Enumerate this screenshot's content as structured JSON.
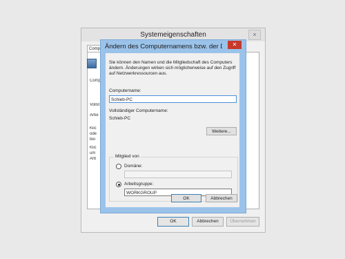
{
  "background_window": {
    "title": "Systemeigenschaften",
    "close_glyph": "×",
    "tab_label": "Compu",
    "fragments": [
      "Comp",
      "Vollst",
      "Arbe",
      "Klic",
      "ode",
      "bei",
      "Klic",
      "um",
      "Arb"
    ],
    "buttons": {
      "ok": "OK",
      "cancel": "Abbrechen",
      "apply": "Übernehmen"
    }
  },
  "dialog": {
    "title": "Ändern des Computernamens bzw. der D...",
    "close_glyph": "✕",
    "intro": "Sie können den Namen und die Mitgliedschaft des Computers ändern. Änderungen wirken sich möglicherweise auf den Zugriff auf Netzwerkressourcen aus.",
    "computer_name_label": "Computername:",
    "computer_name_value": "Schieb-PC",
    "full_name_label": "Vollständiger Computername:",
    "full_name_value": "Schieb-PC",
    "more_button": "Weitere...",
    "member_of_label": "Mitglied von",
    "domain_label": "Domäne:",
    "domain_value": "",
    "workgroup_label": "Arbeitsgruppe:",
    "workgroup_value": "WORKGROUP",
    "selected_membership": "Arbeitsgruppe",
    "ok_button": "OK",
    "cancel_button": "Abbrechen"
  }
}
